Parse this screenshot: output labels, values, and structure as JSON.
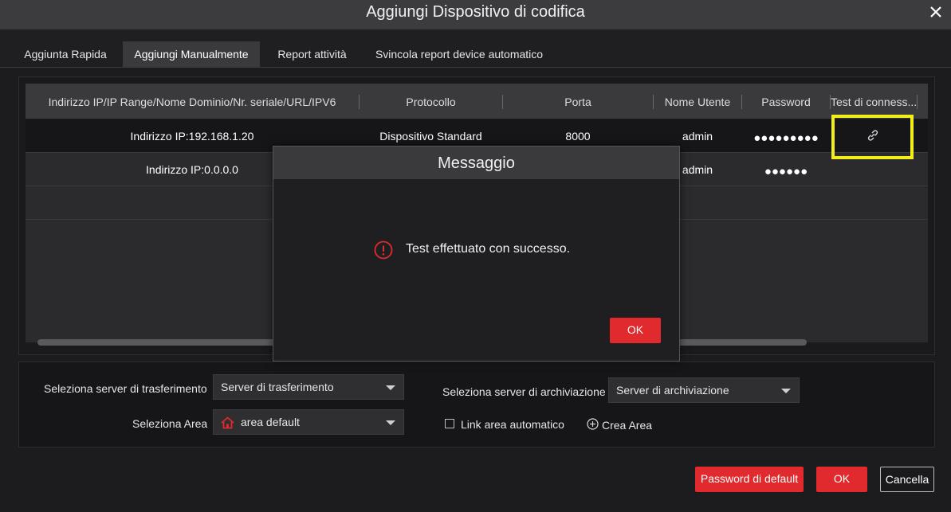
{
  "window": {
    "title": "Aggiungi Dispositivo di codifica",
    "close_icon": "close-icon"
  },
  "tabs": [
    {
      "label": "Aggiunta Rapida",
      "active": false
    },
    {
      "label": "Aggiungi Manualmente",
      "active": true
    },
    {
      "label": "Report attività",
      "active": false
    },
    {
      "label": "Svincola report device automatico",
      "active": false
    }
  ],
  "table": {
    "columns": [
      "Indirizzo IP/IP Range/Nome Dominio/Nr. seriale/URL/IPV6",
      "Protocollo",
      "Porta",
      "Nome Utente",
      "Password",
      "Test di conness..."
    ],
    "rows": [
      {
        "address": "Indirizzo IP:192.168.1.20",
        "protocol": "Dispositivo Standard",
        "port": "8000",
        "user": "admin",
        "password": "●●●●●●●●●",
        "test_icon": "link-icon"
      },
      {
        "address": "Indirizzo IP:0.0.0.0",
        "protocol": "",
        "port": "",
        "user": "admin",
        "password": "●●●●●●",
        "test_icon": ""
      }
    ]
  },
  "settings": {
    "transfer_label": "Seleziona server di trasferimento",
    "transfer_value": "Server di trasferimento",
    "storage_label": "Seleziona server di archiviazione",
    "storage_value": "Server di archiviazione",
    "area_label": "Seleziona Area",
    "area_value": "area default",
    "area_icon": "home-icon",
    "auto_link_label": "Link area automatico",
    "auto_link_checked": false,
    "create_area_label": "Crea Area"
  },
  "footer": {
    "default_password_label": "Password di default",
    "ok_label": "OK",
    "cancel_label": "Cancella"
  },
  "dialog": {
    "title": "Messaggio",
    "message": "Test effettuato con successo.",
    "icon": "warning-icon",
    "ok_label": "OK"
  },
  "colors": {
    "accent": "#e02a2e",
    "highlight": "#f2ee1a",
    "header_bg": "#3a3a3c",
    "background": "#1c1c1e"
  }
}
